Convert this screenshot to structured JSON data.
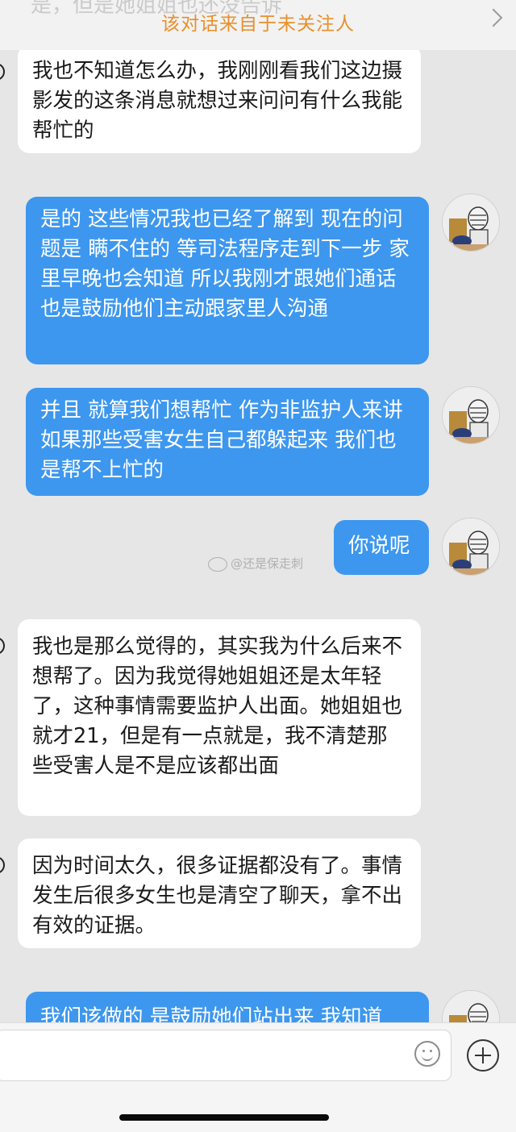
{
  "banner": {
    "ghost_text": "是，但是她姐姐也还没告诉",
    "title": "该对话来自于未关注人"
  },
  "messages": [
    {
      "side": "in",
      "text": "我也不知道怎么办，我刚刚看我们这边摄影发的这条消息就想过来问问有什么我能帮忙的"
    },
    {
      "side": "out",
      "text": "是的 这些情况我也已经了解到 现在的问题是 瞒不住的 等司法程序走到下一步 家里早晚也会知道 所以我刚才跟她们通话也是鼓励他们主动跟家里人沟通"
    },
    {
      "side": "out",
      "text": "并且 就算我们想帮忙 作为非监护人来讲 如果那些受害女生自己都躲起来 我们也是帮不上忙的"
    },
    {
      "side": "out",
      "text": "你说呢"
    },
    {
      "side": "in",
      "text": "我也是那么觉得的，其实我为什么后来不想帮了。因为我觉得她姐姐还是太年轻了，这种事情需要监护人出面。她姐姐也就才21，但是有一点就是，我不清楚那些受害人是不是应该都出面"
    },
    {
      "side": "in",
      "text": "因为时间太久，很多证据都没有了。事情发生后很多女生也是清空了聊天，拿不出有效的证据。"
    },
    {
      "side": "out",
      "text": "我们该做的 是鼓励她们站出来 我知道"
    }
  ],
  "watermark": "@还是保走刺",
  "input": {
    "placeholder": "",
    "emoji_icon": "emoji-icon",
    "plus_icon": "plus-icon"
  },
  "colors": {
    "accent_banner": "#e8902a",
    "outgoing_bubble": "#3d97ee",
    "incoming_bubble": "#ffffff",
    "background": "#e6e6e6"
  }
}
